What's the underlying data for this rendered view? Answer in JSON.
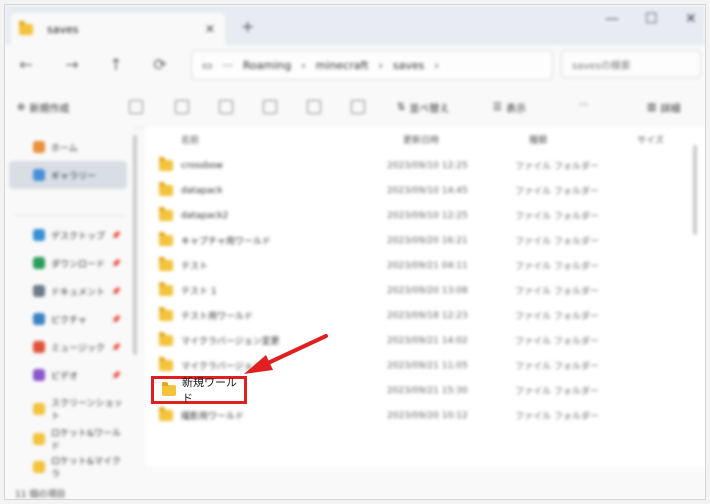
{
  "tab": {
    "title": "saves",
    "close": "✕",
    "new": "+"
  },
  "window_controls": {
    "minimize": "—",
    "maximize": "☐",
    "close": "✕"
  },
  "nav": {
    "back": "←",
    "forward": "→",
    "up": "↑",
    "refresh": "⟳"
  },
  "breadcrumb": [
    "Roaming",
    "›",
    "minecraft",
    "›",
    "saves",
    "›"
  ],
  "breadcrumb_more": "···",
  "search": {
    "placeholder": "savesの検索"
  },
  "command_bar": {
    "new_label": "新規作成",
    "sort_label": "並べ替え",
    "view_label": "表示",
    "more_label": "···",
    "details_label": "詳細"
  },
  "sidebar": {
    "items": [
      {
        "label": "ホーム",
        "color": "#e8913a"
      },
      {
        "label": "ギャラリー",
        "color": "#4a90d9"
      },
      {
        "label": "デスクトップ",
        "color": "#3b8fd6"
      },
      {
        "label": "ダウンロード",
        "color": "#2a9d5a"
      },
      {
        "label": "ドキュメント",
        "color": "#6c7a89"
      },
      {
        "label": "ピクチャ",
        "color": "#3b82c4"
      },
      {
        "label": "ミュージック",
        "color": "#e0533b"
      },
      {
        "label": "ビデオ",
        "color": "#8a56c9"
      },
      {
        "label": "スクリーンショット",
        "color": "#f3c33c"
      },
      {
        "label": "ロケット&ワールド",
        "color": "#f3c33c"
      },
      {
        "label": "ロケット&マイクラ",
        "color": "#f3c33c"
      }
    ],
    "pin": "📌"
  },
  "list": {
    "headers": {
      "name": "名前",
      "date": "更新日時",
      "type": "種類",
      "size": "サイズ"
    },
    "rows": [
      {
        "name": "crossbow",
        "date": "2023/09/10 12:25",
        "type": "ファイル フォルダー"
      },
      {
        "name": "datapack",
        "date": "2023/09/10 14:45",
        "type": "ファイル フォルダー"
      },
      {
        "name": "datapack2",
        "date": "2023/09/10 12:25",
        "type": "ファイル フォルダー"
      },
      {
        "name": "キャプチャ用ワールド",
        "date": "2023/09/20 16:21",
        "type": "ファイル フォルダー"
      },
      {
        "name": "テスト",
        "date": "2023/09/21 04:11",
        "type": "ファイル フォルダー"
      },
      {
        "name": "テスト 1",
        "date": "2023/09/20 13:08",
        "type": "ファイル フォルダー"
      },
      {
        "name": "テスト用ワールド",
        "date": "2023/09/18 12:23",
        "type": "ファイル フォルダー"
      },
      {
        "name": "マイクラバージョン変更",
        "date": "2023/09/21 14:02",
        "type": "ファイル フォルダー"
      },
      {
        "name": "マイクラバージョン",
        "date": "2023/09/21 11:05",
        "type": "ファイル フォルダー"
      },
      {
        "name": "新規ワールド",
        "date": "2023/09/21 15:30",
        "type": "ファイル フォルダー"
      },
      {
        "name": "撮影用ワールド",
        "date": "2023/09/20 10:12",
        "type": "ファイル フォルダー"
      }
    ]
  },
  "highlighted_item": {
    "label": "新規ワールド",
    "color": "#e02020"
  },
  "status": {
    "count": "11 個の項目"
  }
}
